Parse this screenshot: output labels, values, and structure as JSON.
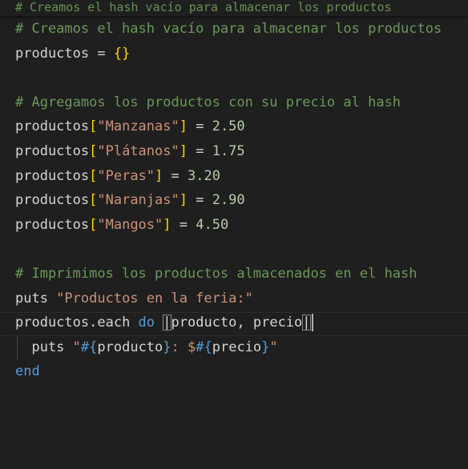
{
  "editor": {
    "sticky_scroll": "# Creamos el hash vacío para almacenar los productos",
    "lines": [
      [
        [
          "# Creamos el hash vacío para almacenar los productos",
          "comment"
        ]
      ],
      [
        [
          "productos",
          "ident"
        ],
        [
          " = ",
          "punct"
        ],
        [
          "{}",
          "brace"
        ]
      ],
      [],
      [
        [
          "# Agregamos los productos con su precio al hash",
          "comment"
        ]
      ],
      [
        [
          "productos",
          "ident"
        ],
        [
          "[",
          "brace"
        ],
        [
          "\"Manzanas\"",
          "string"
        ],
        [
          "]",
          "brace"
        ],
        [
          " = ",
          "punct"
        ],
        [
          "2.50",
          "number"
        ]
      ],
      [
        [
          "productos",
          "ident"
        ],
        [
          "[",
          "brace"
        ],
        [
          "\"Plátanos\"",
          "string"
        ],
        [
          "]",
          "brace"
        ],
        [
          " = ",
          "punct"
        ],
        [
          "1.75",
          "number"
        ]
      ],
      [
        [
          "productos",
          "ident"
        ],
        [
          "[",
          "brace"
        ],
        [
          "\"Peras\"",
          "string"
        ],
        [
          "]",
          "brace"
        ],
        [
          " = ",
          "punct"
        ],
        [
          "3.20",
          "number"
        ]
      ],
      [
        [
          "productos",
          "ident"
        ],
        [
          "[",
          "brace"
        ],
        [
          "\"Naranjas\"",
          "string"
        ],
        [
          "]",
          "brace"
        ],
        [
          " = ",
          "punct"
        ],
        [
          "2.90",
          "number"
        ]
      ],
      [
        [
          "productos",
          "ident"
        ],
        [
          "[",
          "brace"
        ],
        [
          "\"Mangos\"",
          "string"
        ],
        [
          "]",
          "brace"
        ],
        [
          " = ",
          "punct"
        ],
        [
          "4.50",
          "number"
        ]
      ],
      [],
      [
        [
          "# Imprimimos los productos almacenados en el hash",
          "comment"
        ]
      ],
      [
        [
          "puts ",
          "ident"
        ],
        [
          "\"Productos en la feria:\"",
          "string"
        ]
      ],
      [
        [
          "productos",
          "ident"
        ],
        [
          ".each ",
          "ident"
        ],
        [
          "do ",
          "keyword"
        ],
        [
          "|",
          "pipe-box"
        ],
        [
          "producto, precio",
          "ident"
        ],
        [
          "|",
          "pipe-box"
        ],
        [
          "",
          "caret"
        ]
      ],
      [
        [
          "  puts ",
          "ident"
        ],
        [
          "\"",
          "string"
        ],
        [
          "#{",
          "interp"
        ],
        [
          "producto",
          "ident"
        ],
        [
          "}",
          "interp"
        ],
        [
          ": $",
          "string"
        ],
        [
          "#{",
          "interp"
        ],
        [
          "precio",
          "ident"
        ],
        [
          "}",
          "interp"
        ],
        [
          "\"",
          "string"
        ]
      ],
      [
        [
          "end",
          "keyword"
        ]
      ]
    ]
  },
  "colors": {
    "background": "#1f1f1f",
    "comment": "#6a9955",
    "string": "#ce9178",
    "number": "#b5cea8",
    "keyword": "#569cd6",
    "bracket": "#ffd700",
    "default": "#d4d4d4"
  }
}
